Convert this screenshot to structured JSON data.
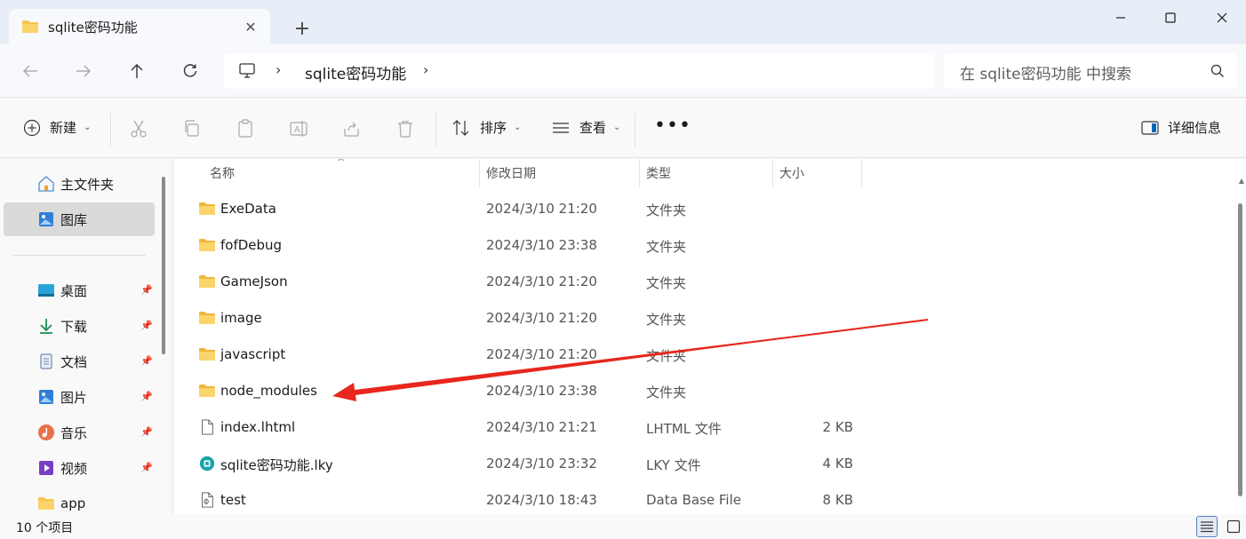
{
  "window": {
    "tab_title": "sqlite密码功能",
    "tab_close": "✕",
    "new_tab": "+",
    "minimize_icon": "minimize-icon",
    "maximize_icon": "maximize-icon",
    "close_icon": "close-icon"
  },
  "address": {
    "current_folder": "sqlite密码功能",
    "search_placeholder": "在 sqlite密码功能 中搜索"
  },
  "toolbar": {
    "new_label": "新建",
    "sort_label": "排序",
    "view_label": "查看",
    "more_label": "•••",
    "details_label": "详细信息"
  },
  "sidebar": {
    "items": [
      {
        "label": "主文件夹",
        "icon": "home-icon"
      },
      {
        "label": "图库",
        "icon": "gallery-icon",
        "selected": true
      },
      {
        "label": "桌面",
        "icon": "desktop-icon",
        "pinned": true
      },
      {
        "label": "下载",
        "icon": "download-icon",
        "pinned": true
      },
      {
        "label": "文档",
        "icon": "document-icon",
        "pinned": true
      },
      {
        "label": "图片",
        "icon": "pictures-icon",
        "pinned": true
      },
      {
        "label": "音乐",
        "icon": "music-icon",
        "pinned": true
      },
      {
        "label": "视频",
        "icon": "video-icon",
        "pinned": true
      },
      {
        "label": "app",
        "icon": "folder-icon"
      }
    ]
  },
  "columns": {
    "name": "名称",
    "date": "修改日期",
    "type": "类型",
    "size": "大小"
  },
  "files": [
    {
      "name": "ExeData",
      "date": "2024/3/10 21:20",
      "type": "文件夹",
      "size": "",
      "icon": "folder-icon"
    },
    {
      "name": "fofDebug",
      "date": "2024/3/10 23:38",
      "type": "文件夹",
      "size": "",
      "icon": "folder-icon"
    },
    {
      "name": "GameJson",
      "date": "2024/3/10 21:20",
      "type": "文件夹",
      "size": "",
      "icon": "folder-icon"
    },
    {
      "name": "image",
      "date": "2024/3/10 21:20",
      "type": "文件夹",
      "size": "",
      "icon": "folder-icon"
    },
    {
      "name": "javascript",
      "date": "2024/3/10 21:20",
      "type": "文件夹",
      "size": "",
      "icon": "folder-icon"
    },
    {
      "name": "node_modules",
      "date": "2024/3/10 23:38",
      "type": "文件夹",
      "size": "",
      "icon": "folder-icon"
    },
    {
      "name": "index.lhtml",
      "date": "2024/3/10 21:21",
      "type": "LHTML 文件",
      "size": "2 KB",
      "icon": "file-icon"
    },
    {
      "name": "sqlite密码功能.lky",
      "date": "2024/3/10 23:32",
      "type": "LKY 文件",
      "size": "4 KB",
      "icon": "app-file-icon"
    },
    {
      "name": "test",
      "date": "2024/3/10 18:43",
      "type": "Data Base File",
      "size": "8 KB",
      "icon": "database-file-icon"
    }
  ],
  "status": {
    "item_count": "10 个项目"
  },
  "colors": {
    "accent": "#0067c0",
    "folder": "#f8c54c",
    "arrow": "#e8261d"
  }
}
